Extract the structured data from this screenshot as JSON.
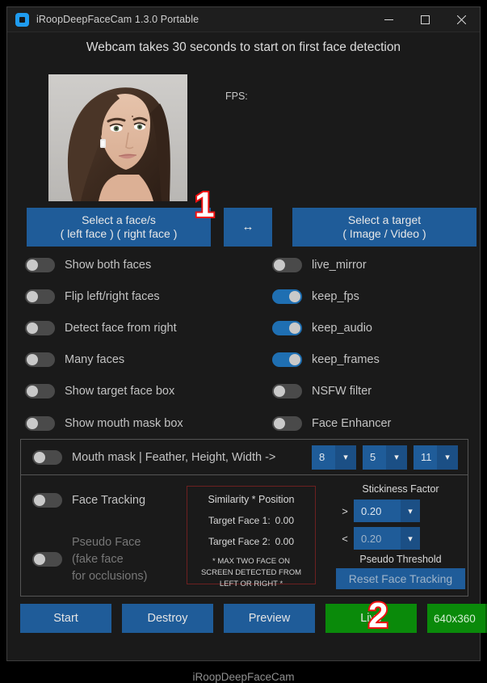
{
  "window": {
    "title": "iRoopDeepFaceCam 1.3.0 Portable",
    "icon": "app-logo-icon",
    "minimize": "minimize-icon",
    "maximize": "maximize-icon",
    "close": "close-icon"
  },
  "headline": "Webcam takes 30 seconds to start on first face detection",
  "preview": {
    "hint": "|",
    "fps_label": "FPS:"
  },
  "buttons": {
    "select_face_line1": "Select a face/s",
    "select_face_line2": "( left face ) ( right face )",
    "swap": "↔",
    "select_target_line1": "Select a target",
    "select_target_line2": "( Image / Video )"
  },
  "toggles_left": [
    {
      "label": "Show both faces",
      "on": false
    },
    {
      "label": "Flip left/right faces",
      "on": false
    },
    {
      "label": "Detect face from right",
      "on": false
    },
    {
      "label": "Many faces",
      "on": false
    },
    {
      "label": "Show target face box",
      "on": false
    },
    {
      "label": "Show mouth mask box",
      "on": false
    }
  ],
  "toggles_right": [
    {
      "label": "live_mirror",
      "on": false
    },
    {
      "label": "keep_fps",
      "on": true
    },
    {
      "label": "keep_audio",
      "on": true
    },
    {
      "label": "keep_frames",
      "on": true
    },
    {
      "label": "NSFW filter",
      "on": false
    },
    {
      "label": "Face Enhancer",
      "on": false
    }
  ],
  "mouth_mask": {
    "label": "Mouth mask | Feather, Height, Width ->",
    "on": false,
    "feather": "8",
    "height": "5",
    "width": "11"
  },
  "tracking": {
    "face_tracking_label": "Face Tracking",
    "face_tracking_on": false,
    "pseudo_line1": "Pseudo Face",
    "pseudo_line2": "(fake face",
    "pseudo_line3": "for occlusions)",
    "pseudo_on": false,
    "sim_title": "Similarity * Position",
    "target1_label": "Target Face 1:",
    "target1_value": "0.00",
    "target2_label": "Target Face 2:",
    "target2_value": "0.00",
    "note_line1": "* MAX TWO FACE ON",
    "note_line2": "SCREEN DETECTED FROM",
    "note_line3": "LEFT OR RIGHT *",
    "stickiness_title": "Stickiness Factor",
    "greater_op": ">",
    "greater_value": "0.20",
    "less_op": "<",
    "less_value": "0.20",
    "pseudo_threshold": "Pseudo Threshold",
    "reset_label": "Reset Face Tracking"
  },
  "bottom": {
    "start": "Start",
    "destroy": "Destroy",
    "preview": "Preview",
    "live": "Live",
    "resolution": "640x360"
  },
  "footer": "iRoopDeepFaceCam",
  "markers": {
    "one": "1",
    "two": "2"
  },
  "colors": {
    "accent_blue": "#1f5c99",
    "green": "#0a8a0a",
    "marker_red": "#ee1111",
    "window_bg": "#1a1a1a"
  }
}
